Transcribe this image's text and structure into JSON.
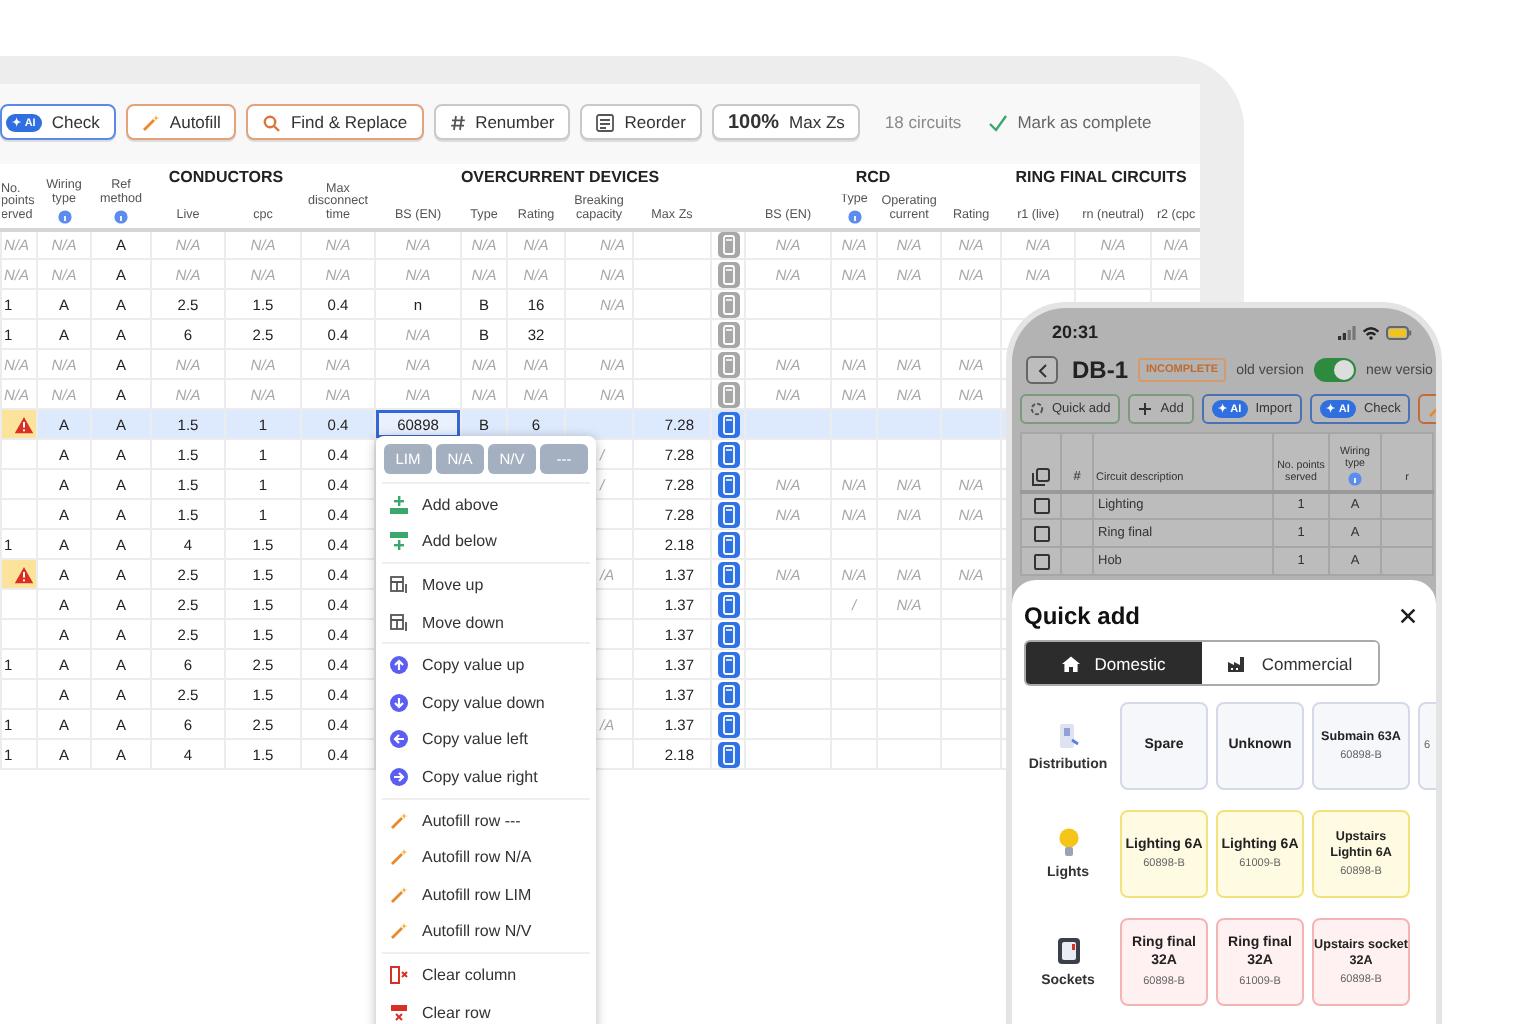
{
  "toolbar": {
    "buttons": [
      {
        "kind": "ai",
        "badge": "✦ AI",
        "label": "Check"
      },
      {
        "kind": "wand",
        "label": "Autofill"
      },
      {
        "kind": "find",
        "label": "Find & Replace"
      },
      {
        "kind": "hash",
        "label": "Renumber"
      },
      {
        "kind": "reorder",
        "label": "Reorder"
      },
      {
        "kind": "percent",
        "value": "100%",
        "label": "Max Zs"
      }
    ],
    "circuit_count": "18 circuits",
    "mark_complete": "Mark as complete"
  },
  "table": {
    "header": [
      {
        "kind": "single",
        "label": "No. points erved"
      },
      {
        "kind": "single",
        "label": "Wiring type",
        "info": true
      },
      {
        "kind": "single",
        "label": "Ref method",
        "info": true
      },
      {
        "kind": "group",
        "label": "CONDUCTORS",
        "columns": [
          {
            "label": "Live"
          },
          {
            "label": "cpc"
          }
        ]
      },
      {
        "kind": "single",
        "label": "Max disconnect time"
      },
      {
        "kind": "group",
        "label": "OVERCURRENT DEVICES",
        "columns": [
          {
            "label": "BS (EN)"
          },
          {
            "label": "Type"
          },
          {
            "label": "Rating"
          },
          {
            "label": "Breaking capacity"
          },
          {
            "label": "Max Zs"
          },
          {
            "kind": "calc"
          }
        ]
      },
      {
        "kind": "group",
        "label": "RCD",
        "columns": [
          {
            "label": "BS (EN)"
          },
          {
            "label": "Type",
            "info": true
          },
          {
            "label": "Operating current"
          },
          {
            "label": "Rating"
          }
        ]
      },
      {
        "kind": "group",
        "label": "RING FINAL CIRCUITS",
        "columns": [
          {
            "label": "r1 (live)"
          },
          {
            "label": "rn (neutral)"
          },
          {
            "label": "r2 (cpc"
          }
        ]
      }
    ],
    "rows": [
      {
        "warning": false,
        "selected": false,
        "calc_active": false,
        "cells": [
          {
            "placeholder": "N/A"
          },
          {
            "placeholder": "N/A"
          },
          "A",
          {
            "placeholder": "N/A"
          },
          {
            "placeholder": "N/A"
          },
          {
            "placeholder": "N/A"
          },
          {
            "placeholder": "N/A"
          },
          {
            "placeholder": "N/A"
          },
          {
            "placeholder": "N/A"
          },
          {
            "placeholder": "N/A"
          },
          null,
          {
            "placeholder": "N/A"
          },
          {
            "placeholder": "N/A"
          },
          {
            "placeholder": "N/A"
          },
          {
            "placeholder": "N/A"
          },
          {
            "placeholder": "N/A"
          },
          {
            "placeholder": "N/A"
          },
          {
            "placeholder": "N/A"
          }
        ]
      },
      {
        "warning": false,
        "selected": false,
        "calc_active": false,
        "cells": [
          {
            "placeholder": "N/A"
          },
          {
            "placeholder": "N/A"
          },
          "A",
          {
            "placeholder": "N/A"
          },
          {
            "placeholder": "N/A"
          },
          {
            "placeholder": "N/A"
          },
          {
            "placeholder": "N/A"
          },
          {
            "placeholder": "N/A"
          },
          {
            "placeholder": "N/A"
          },
          {
            "placeholder": "N/A"
          },
          null,
          {
            "placeholder": "N/A"
          },
          {
            "placeholder": "N/A"
          },
          {
            "placeholder": "N/A"
          },
          {
            "placeholder": "N/A"
          },
          {
            "placeholder": "N/A"
          },
          {
            "placeholder": "N/A"
          },
          {
            "placeholder": "N/A"
          }
        ]
      },
      {
        "warning": false,
        "selected": false,
        "calc_active": false,
        "cells": [
          "1",
          "A",
          "A",
          "2.5",
          "1.5",
          "0.4",
          "n",
          "B",
          "16",
          {
            "placeholder": "N/A"
          },
          null,
          null,
          null,
          null,
          null,
          null,
          null,
          null
        ]
      },
      {
        "warning": false,
        "selected": false,
        "calc_active": false,
        "cells": [
          "1",
          "A",
          "A",
          "6",
          "2.5",
          "0.4",
          {
            "placeholder": "N/A"
          },
          "B",
          "32",
          null,
          null,
          null,
          null,
          null,
          null,
          null,
          null,
          null
        ]
      },
      {
        "warning": false,
        "selected": false,
        "calc_active": false,
        "cells": [
          {
            "placeholder": "N/A"
          },
          {
            "placeholder": "N/A"
          },
          "A",
          {
            "placeholder": "N/A"
          },
          {
            "placeholder": "N/A"
          },
          {
            "placeholder": "N/A"
          },
          {
            "placeholder": "N/A"
          },
          {
            "placeholder": "N/A"
          },
          {
            "placeholder": "N/A"
          },
          {
            "placeholder": "N/A"
          },
          null,
          {
            "placeholder": "N/A"
          },
          {
            "placeholder": "N/A"
          },
          {
            "placeholder": "N/A"
          },
          {
            "placeholder": "N/A"
          },
          null,
          null,
          null
        ]
      },
      {
        "warning": false,
        "selected": false,
        "calc_active": false,
        "cells": [
          {
            "placeholder": "N/A"
          },
          {
            "placeholder": "N/A"
          },
          "A",
          {
            "placeholder": "N/A"
          },
          {
            "placeholder": "N/A"
          },
          {
            "placeholder": "N/A"
          },
          {
            "placeholder": "N/A"
          },
          {
            "placeholder": "N/A"
          },
          {
            "placeholder": "N/A"
          },
          {
            "placeholder": "N/A"
          },
          null,
          {
            "placeholder": "N/A"
          },
          {
            "placeholder": "N/A"
          },
          {
            "placeholder": "N/A"
          },
          {
            "placeholder": "N/A"
          },
          null,
          null,
          null
        ]
      },
      {
        "warning": true,
        "selected": true,
        "calc_active": true,
        "cells": [
          null,
          "A",
          "A",
          "1.5",
          "1",
          "0.4",
          {
            "value": "60898",
            "focused": true
          },
          "B",
          "6",
          null,
          "7.28",
          null,
          null,
          null,
          null,
          null,
          null,
          null
        ]
      },
      {
        "warning": false,
        "selected": false,
        "calc_active": true,
        "cells": [
          null,
          "A",
          "A",
          "1.5",
          "1",
          "0.4",
          null,
          null,
          null,
          {
            "placeholder": "/"
          },
          "7.28",
          null,
          null,
          null,
          null,
          null,
          null,
          null
        ]
      },
      {
        "warning": false,
        "selected": false,
        "calc_active": true,
        "cells": [
          null,
          "A",
          "A",
          "1.5",
          "1",
          "0.4",
          null,
          null,
          null,
          {
            "placeholder": "/"
          },
          "7.28",
          {
            "placeholder": "N/A"
          },
          {
            "placeholder": "N/A"
          },
          {
            "placeholder": "N/A"
          },
          {
            "placeholder": "N/A"
          },
          null,
          null,
          null
        ]
      },
      {
        "warning": false,
        "selected": false,
        "calc_active": true,
        "cells": [
          null,
          "A",
          "A",
          "1.5",
          "1",
          "0.4",
          null,
          null,
          null,
          null,
          "7.28",
          {
            "placeholder": "N/A"
          },
          {
            "placeholder": "N/A"
          },
          {
            "placeholder": "N/A"
          },
          {
            "placeholder": "N/A"
          },
          null,
          null,
          null
        ]
      },
      {
        "warning": false,
        "selected": false,
        "calc_active": true,
        "cells": [
          "1",
          "A",
          "A",
          "4",
          "1.5",
          "0.4",
          null,
          null,
          null,
          null,
          "2.18",
          null,
          null,
          null,
          null,
          null,
          null,
          null
        ]
      },
      {
        "warning": true,
        "selected": false,
        "calc_active": true,
        "cells": [
          null,
          "A",
          "A",
          "2.5",
          "1.5",
          "0.4",
          null,
          null,
          null,
          {
            "placeholder": "/A"
          },
          "1.37",
          {
            "placeholder": "N/A"
          },
          {
            "placeholder": "N/A"
          },
          {
            "placeholder": "N/A"
          },
          {
            "placeholder": "N/A"
          },
          null,
          null,
          null
        ]
      },
      {
        "warning": false,
        "selected": false,
        "calc_active": true,
        "cells": [
          null,
          "A",
          "A",
          "2.5",
          "1.5",
          "0.4",
          null,
          null,
          null,
          null,
          "1.37",
          null,
          {
            "placeholder": "/"
          },
          {
            "placeholder": "N/A"
          },
          null,
          null,
          null,
          null
        ]
      },
      {
        "warning": false,
        "selected": false,
        "calc_active": true,
        "cells": [
          null,
          "A",
          "A",
          "2.5",
          "1.5",
          "0.4",
          null,
          null,
          null,
          null,
          "1.37",
          null,
          null,
          null,
          null,
          null,
          null,
          null
        ]
      },
      {
        "warning": false,
        "selected": false,
        "calc_active": true,
        "cells": [
          "1",
          "A",
          "A",
          "6",
          "2.5",
          "0.4",
          null,
          null,
          null,
          null,
          "1.37",
          null,
          null,
          null,
          null,
          null,
          null,
          null
        ]
      },
      {
        "warning": false,
        "selected": false,
        "calc_active": true,
        "cells": [
          null,
          "A",
          "A",
          "2.5",
          "1.5",
          "0.4",
          null,
          null,
          null,
          null,
          "1.37",
          null,
          null,
          null,
          null,
          null,
          null,
          null
        ]
      },
      {
        "warning": false,
        "selected": false,
        "calc_active": true,
        "cells": [
          "1",
          "A",
          "A",
          "6",
          "2.5",
          "0.4",
          null,
          null,
          null,
          {
            "placeholder": "/A"
          },
          "1.37",
          null,
          null,
          null,
          null,
          null,
          null,
          null
        ]
      },
      {
        "warning": false,
        "selected": false,
        "calc_active": true,
        "cells": [
          "1",
          "A",
          "A",
          "4",
          "1.5",
          "0.4",
          null,
          null,
          null,
          null,
          "2.18",
          null,
          null,
          null,
          null,
          null,
          null,
          null
        ]
      }
    ]
  },
  "context_menu": {
    "chips": [
      "LIM",
      "N/A",
      "N/V",
      "---"
    ],
    "groups": [
      [
        {
          "kind": "add_above",
          "label": "Add above"
        },
        {
          "kind": "add_below",
          "label": "Add below"
        }
      ],
      [
        {
          "kind": "move",
          "label": "Move up"
        },
        {
          "kind": "move",
          "label": "Move down"
        }
      ],
      [
        {
          "kind": "copy_up",
          "label": "Copy value up"
        },
        {
          "kind": "copy_down",
          "label": "Copy value down"
        },
        {
          "kind": "copy_left",
          "label": "Copy value left"
        },
        {
          "kind": "copy_right",
          "label": "Copy value right"
        }
      ],
      [
        {
          "kind": "autofill",
          "label": "Autofill row ---"
        },
        {
          "kind": "autofill",
          "label": "Autofill row N/A"
        },
        {
          "kind": "autofill",
          "label": "Autofill row LIM"
        },
        {
          "kind": "autofill",
          "label": "Autofill row N/V"
        }
      ],
      [
        {
          "kind": "clear_column",
          "label": "Clear column"
        },
        {
          "kind": "clear_row",
          "label": "Clear row"
        }
      ]
    ]
  },
  "phone": {
    "time": "20:31",
    "title": "DB-1",
    "status": "INCOMPLETE",
    "old_label": "old version",
    "version_switch_on": true,
    "new_label": "new versio",
    "actions": [
      {
        "kind": "quick",
        "label": "Quick add"
      },
      {
        "kind": "add",
        "label": "Add"
      },
      {
        "kind": "ai",
        "badge": "✦ AI",
        "label": "Import"
      },
      {
        "kind": "ai",
        "badge": "✦ AI",
        "label": "Check"
      },
      {
        "kind": "wand"
      }
    ],
    "table": {
      "columns": [
        {
          "kind": "select"
        },
        {
          "label": "#"
        },
        {
          "label": "Circuit description"
        },
        {
          "label": "No. points served"
        },
        {
          "label": "Wiring type",
          "info": true
        },
        {
          "label": "r"
        }
      ],
      "rows": [
        {
          "checked": false,
          "description": "Lighting",
          "points": "1",
          "wiring": "A"
        },
        {
          "checked": false,
          "description": "Ring final",
          "points": "1",
          "wiring": "A"
        },
        {
          "checked": false,
          "description": "Hob",
          "points": "1",
          "wiring": "A"
        }
      ]
    },
    "sheet": {
      "title": "Quick add",
      "tabs": [
        {
          "kind": "house",
          "label": "Domestic",
          "selected": true
        },
        {
          "kind": "factory",
          "label": "Commercial",
          "selected": false
        }
      ],
      "categories": [
        {
          "kind": "distribution",
          "label": "Distribution",
          "color": "#d3d9e6",
          "tiles": [
            {
              "title": "Spare"
            },
            {
              "title": "Unknown"
            },
            {
              "title": "Submain 63A",
              "standard": "60898-B"
            },
            {
              "standard": "6"
            }
          ]
        },
        {
          "kind": "lights",
          "label": "Lights",
          "color": "#f2e27c",
          "tiles": [
            {
              "title": "Lighting 6A",
              "standard": "60898-B"
            },
            {
              "title": "Lighting 6A",
              "standard": "61009-B"
            },
            {
              "title": "Upstairs Lightin 6A",
              "standard": "60898-B"
            }
          ]
        },
        {
          "kind": "sockets",
          "label": "Sockets",
          "color": "#f4b4b4",
          "tiles": [
            {
              "title": "Ring final 32A",
              "standard": "60898-B"
            },
            {
              "title": "Ring final 32A",
              "standard": "61009-B"
            },
            {
              "title": "Upstairs socket 32A",
              "standard": "60898-B"
            }
          ]
        }
      ]
    }
  }
}
